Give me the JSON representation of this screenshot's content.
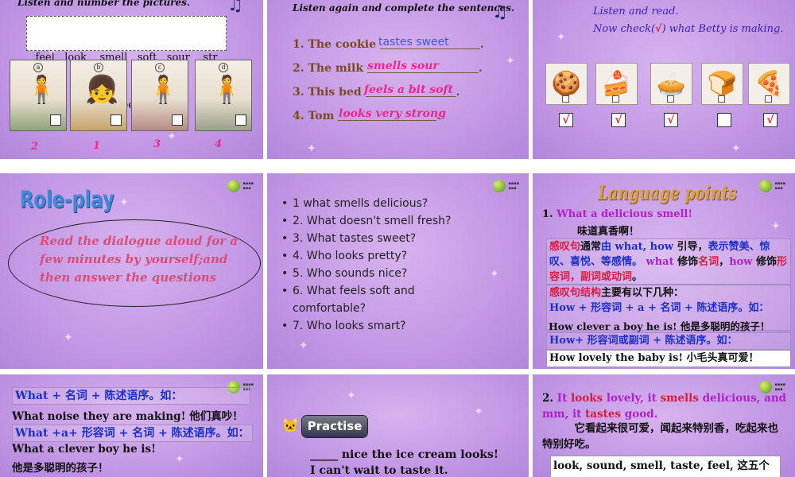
{
  "slide1": {
    "instruction": "Listen and number the pictures.",
    "word_box_line1": "feel   look    smell   soft   sour    str",
    "word_box_line2": "ong    sweet    taste",
    "pictures": [
      "a",
      "b",
      "c",
      "d"
    ],
    "numbers": [
      "2",
      "1",
      "3",
      "4"
    ]
  },
  "slide2": {
    "instruction": "Listen again and complete the sentences.",
    "sentences": [
      {
        "num": "1.",
        "prefix": "The cookie",
        "answer": "tastes sweet",
        "suffix": "."
      },
      {
        "num": "2.",
        "prefix": "The milk",
        "answer": "smells sour",
        "suffix": "."
      },
      {
        "num": "3.",
        "prefix": "This bed",
        "answer": "feels a bit soft",
        "suffix": "."
      },
      {
        "num": "4.",
        "prefix": "Tom",
        "answer": "looks very strong",
        "suffix": "."
      }
    ]
  },
  "slide3": {
    "line1": "Listen and read.",
    "line2_pre": "Now check(",
    "line2_mark": "√",
    "line2_post": ") what Betty is making.",
    "checks": [
      "√",
      "√",
      "√",
      "",
      "√"
    ]
  },
  "slide4": {
    "title": "Role-play",
    "body": "Read the dialogue aloud for a few minutes by yourself;and then answer the questions"
  },
  "slide5": {
    "questions": [
      "1 what smells delicious?",
      "2. What doesn't smell fresh?",
      "3. What tastes sweet?",
      "4. Who looks pretty?",
      "5. Who sounds nice?",
      "6. What feels soft and comfortable?",
      "7. Who looks smart?"
    ]
  },
  "slide6": {
    "title": "Language points",
    "p1_num": "1.",
    "p1_en": "What a delicious smell!",
    "p1_cn": "味道真香啊！",
    "box1_a": "感叹句",
    "box1_b": "通常",
    "box1_c": "由 what, how",
    "box1_d": " 引导，",
    "box1_e": "表示赞美、惊叹、喜悦、等感情。",
    "box1_f": " what",
    "box1_g": " 修饰",
    "box1_h": "名词",
    "box1_i": "，",
    "box1_j": "how",
    "box1_k": " 修饰",
    "box1_l": "形容词，副词或动词",
    "box1_m": "。",
    "box2_a": "感叹句结构",
    "box2_b": "主要有以下几种：",
    "box2_c": "How + 形容词 + a + 名词 + 陈述语序。如：",
    "box2_ex": "How clever a boy he is!  他是多聪明的孩子！",
    "box3": "How+ 形容词或副词 + 陈述语序。如：",
    "box3_ex": "How lovely the baby is!  小毛头真可爱！"
  },
  "slide7": {
    "rule1": "What + 名词 + 陈述语序。如：",
    "ex1": "What noise they are making!  他们真吵！",
    "rule2": "What +a+ 形容词 + 名词 + 陈述语序。如：",
    "ex2a": "What a clever boy he is!",
    "ex2b": "他是多聪明的孩子！"
  },
  "slide8": {
    "badge": "Practise",
    "blank1": "_____",
    "line1": " nice the ice cream looks!",
    "line2": "I can't wait to taste it."
  },
  "slide9": {
    "p2_num": "2.",
    "p2_a": "It ",
    "p2_b": "looks",
    "p2_c": " lovely, it ",
    "p2_d": "smells",
    "p2_e": " delicious, and mm, it ",
    "p2_f": "tastes",
    "p2_g": " good.",
    "cn": "它看起来很可爱，闻起来特别香，吃起来也特别好吃。",
    "box": "look, sound, smell, taste, feel, 这五个动"
  },
  "colors": {
    "slide_bg": "#c59ae6",
    "answer_pink": "#e8288a",
    "title_blue": "#1b2fc9",
    "accent_purple": "#b020c8",
    "accent_red": "#d81b3e"
  }
}
